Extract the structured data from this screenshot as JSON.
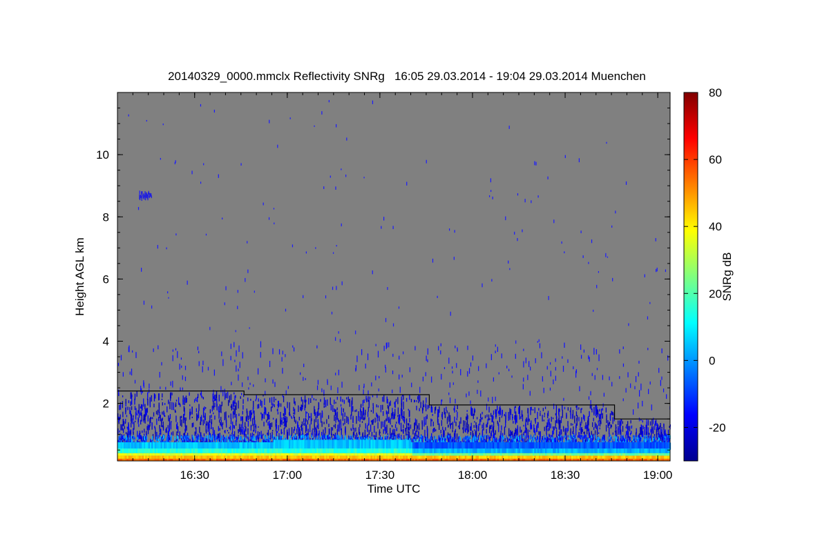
{
  "chart_data": {
    "type": "heatmap",
    "title": "20140329_0000.mmclx Reflectivity SNRg   16:05 29.03.2014 - 19:04 29.03.2014 Muenchen",
    "xlabel": "Time UTC",
    "ylabel": "Height AGL km",
    "colorbar_label": "SNRg dB",
    "x_range": [
      "16:05",
      "19:04"
    ],
    "x_ticks": [
      "16:30",
      "17:00",
      "17:30",
      "18:00",
      "18:30",
      "19:00"
    ],
    "y_range": [
      0.15,
      12.0
    ],
    "y_ticks": [
      2,
      4,
      6,
      8,
      10
    ],
    "colorbar_range": [
      -30,
      80
    ],
    "colorbar_ticks": [
      -20,
      0,
      20,
      40,
      60,
      80
    ],
    "colormap": "jet",
    "background_color": "#808080",
    "cloud_base_line": [
      {
        "start": "16:05",
        "end": "16:46",
        "height_km": 2.4
      },
      {
        "start": "16:46",
        "end": "17:46",
        "height_km": 2.28
      },
      {
        "start": "17:46",
        "end": "18:46",
        "height_km": 1.95
      },
      {
        "start": "18:46",
        "end": "19:04",
        "height_km": 1.5
      }
    ],
    "features": [
      {
        "name": "surface layer",
        "height_km": [
          0.15,
          0.4
        ],
        "snr_db": 45
      },
      {
        "name": "boundary layer echoes",
        "height_km": [
          0.4,
          1.2
        ],
        "snr_db": 5
      },
      {
        "name": "scattered echoes",
        "height_km": [
          1.2,
          4.0
        ],
        "snr_db": -20
      },
      {
        "name": "isolated echo patch",
        "time": "16:13",
        "height_km": 8.7,
        "snr_db": -20
      }
    ]
  }
}
